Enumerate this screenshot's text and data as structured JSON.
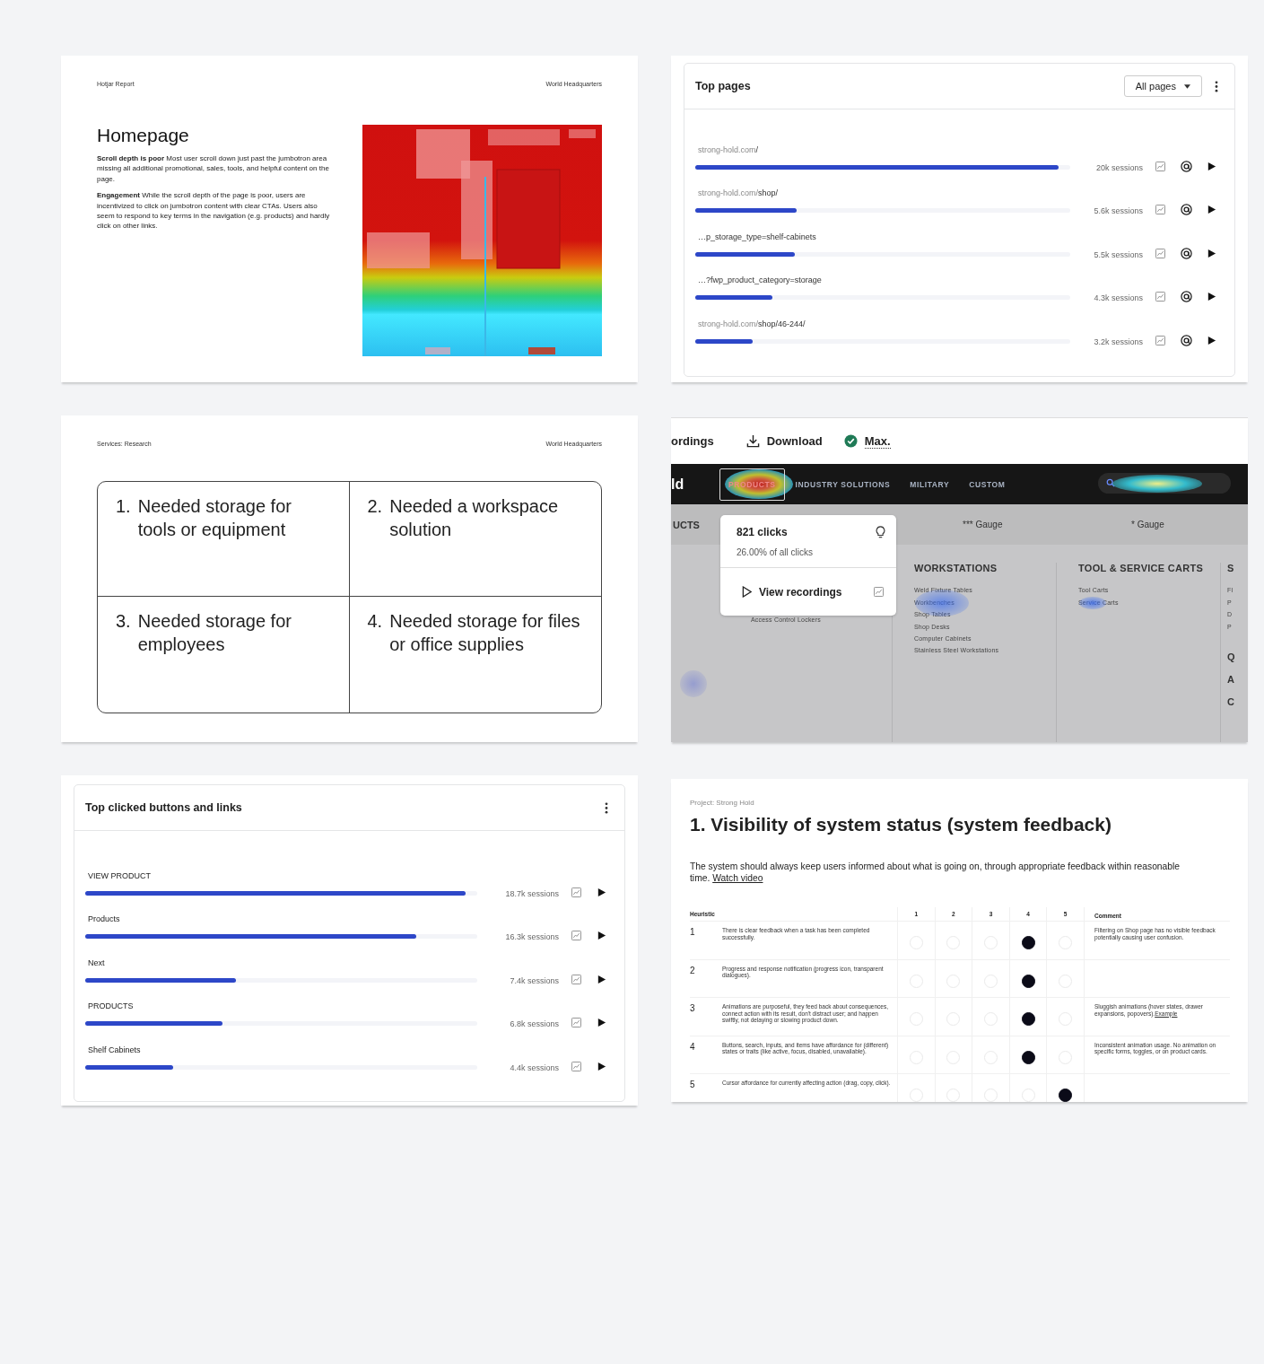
{
  "report_slide": {
    "header_left": "Hotjar Report",
    "header_right": "World Headquarters",
    "title": "Homepage",
    "paragraphs": [
      "**Scroll depth is poor** Most user scroll down just past the jumbotron area missing all additional promotional, sales, tools, and helpful content on the page.",
      "**Engagement** While the scroll depth of the page is poor, users are incentivized to click on jumbotron content with clear CTAs. Users also seem to respond to key terms in the navigation (e.g. products) and hardly click on other links."
    ],
    "picture": {
      "kind": "picture"
    }
  },
  "top_pages": {
    "title": "Top pages",
    "filter": "All pages",
    "rows": [
      {
        "prefix": "strong-hold.com",
        "path": "/",
        "level": 0.97,
        "sessions": "20k sessions"
      },
      {
        "prefix": "strong-hold.com/",
        "path": "shop/",
        "level": 0.27,
        "sessions": "5.6k sessions"
      },
      {
        "path": "…p_storage_type=shelf-cabinets",
        "level": 0.265,
        "sessions": "5.5k sessions"
      },
      {
        "path": "…?fwp_product_category=storage",
        "level": 0.205,
        "sessions": "4.3k sessions"
      },
      {
        "prefix": "strong-hold.com/",
        "path": "shop/46-244/",
        "level": 0.153,
        "sessions": "3.2k sessions"
      }
    ]
  },
  "research_slide": {
    "header_left": "Services: Research",
    "header_right": "World Headquarters",
    "needs": [
      {
        "number": "1.",
        "text": "Needed storage for tools or equipment"
      },
      {
        "number": "2.",
        "text": "Needed a workspace solution"
      },
      {
        "number": "3.",
        "text": "Needed storage for employees"
      },
      {
        "number": "4.",
        "text": "Needed storage for files or office supplies"
      }
    ]
  },
  "heatmap_view": {
    "toolbar": {
      "tab": "ordings",
      "download": "Download",
      "mode": "Max."
    },
    "nav": {
      "logo": "ld",
      "items": [
        {
          "label": "PRODUCTS",
          "selected": true
        },
        {
          "label": "INDUSTRY SOLUTIONS",
          "selected": false
        },
        {
          "label": "MILITARY",
          "selected": false
        },
        {
          "label": "CUSTOM",
          "selected": false
        }
      ]
    },
    "subbar": [
      "UCTS",
      "*** Gauge",
      "* Gauge"
    ],
    "columns": [
      {
        "links": [
          "Access Control Lockers"
        ]
      },
      {
        "heading": "WORKSTATIONS",
        "links": [
          "Weld Fixture Tables",
          "Workbenches",
          "Shop Tables",
          "Shop Desks",
          "Computer Cabinets",
          "Stainless Steel Workstations"
        ]
      },
      {
        "heading": "TOOL & SERVICE CARTS",
        "links": [
          "Tool Carts",
          "Service Carts"
        ]
      },
      {
        "heading": "S",
        "links": [
          "Fl",
          "P",
          "D",
          "P"
        ],
        "more": [
          "Q",
          "A",
          "C"
        ]
      }
    ],
    "tooltip": {
      "clicks": "821 clicks",
      "share": "26.00% of all clicks",
      "action": "View recordings"
    }
  },
  "top_clicked": {
    "title": "Top clicked buttons and links",
    "rows": [
      {
        "label": "VIEW PRODUCT",
        "level": 0.97,
        "sessions": "18.7k sessions"
      },
      {
        "label": "Products",
        "level": 0.845,
        "sessions": "16.3k sessions"
      },
      {
        "label": "Next",
        "level": 0.385,
        "sessions": "7.4k sessions"
      },
      {
        "label": "PRODUCTS",
        "level": 0.35,
        "sessions": "6.8k sessions"
      },
      {
        "label": "Shelf Cabinets",
        "level": 0.225,
        "sessions": "4.4k sessions"
      }
    ]
  },
  "heuristics": {
    "project": "Project: Strong Hold",
    "title": "1. Visibility of system status (system feedback)",
    "description": "The system should always keep users informed about what is going on, through appropriate feedback within reasonable time.",
    "link": "Watch video",
    "columns": [
      "Heuristic",
      "1",
      "2",
      "3",
      "4",
      "5",
      "Comment"
    ],
    "rows": [
      {
        "number": "1",
        "text": "There is clear feedback when a task has been completed successfully.",
        "ratings": [
          false,
          false,
          false,
          true,
          false
        ],
        "comment": "Filtering on Shop page has no visible feedback potentially causing user confusion."
      },
      {
        "number": "2",
        "text": "Progress and response notification (progress icon, transparent dialogues).",
        "ratings": [
          false,
          false,
          false,
          true,
          false
        ]
      },
      {
        "number": "3",
        "text": "Animations are purposeful, they feed back about consequences, connect action with its result, don't distract user; and happen swiftly, not delaying or slowing product down.",
        "ratings": [
          false,
          false,
          false,
          true,
          false
        ],
        "comment": "Sluggish animations (hover states, drawer expansions, popovers).",
        "comment_link": "Example"
      },
      {
        "number": "4",
        "text": "Buttons, search, inputs, and items have affordance for (different) states or traits (like active, focus, disabled, unavailable).",
        "ratings": [
          false,
          false,
          false,
          true,
          false
        ],
        "comment": "Inconsistent animation usage. No animation on specific forms, toggles, or on product cards."
      },
      {
        "number": "5",
        "text": "Cursor affordance for currently affecting action (drag, copy, click).",
        "ratings": [
          false,
          false,
          false,
          false,
          true
        ]
      }
    ]
  }
}
